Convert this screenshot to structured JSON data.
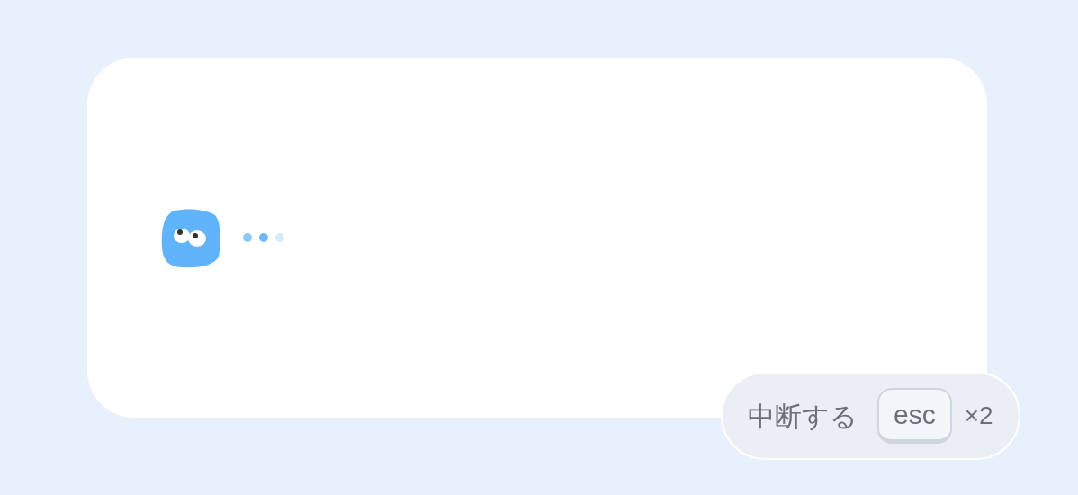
{
  "interrupt_hint": {
    "label": "中断する",
    "key": "esc",
    "count": "×2"
  }
}
